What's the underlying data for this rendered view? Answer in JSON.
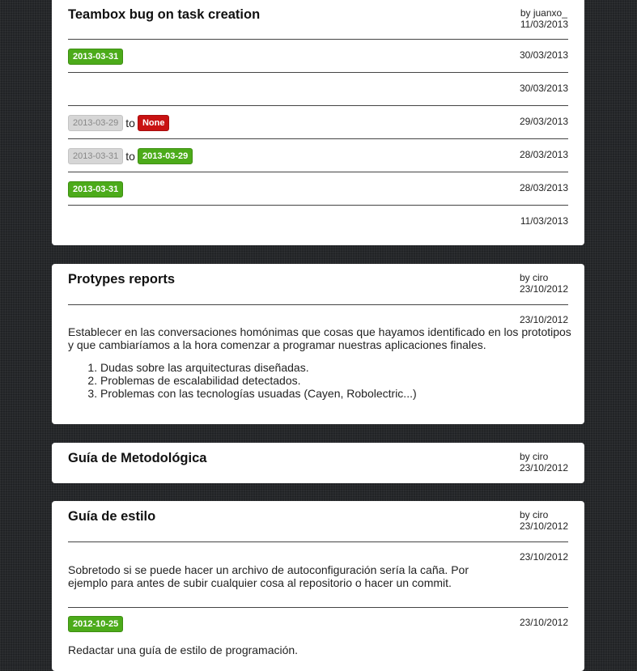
{
  "posts": [
    {
      "title": "Teambox bug on task creation",
      "author": "by juanxo_",
      "date": "11/03/2013",
      "rows": [
        {
          "from": null,
          "to": {
            "text": "2013-03-31",
            "color": "green"
          },
          "date": "30/03/2013"
        },
        {
          "from": null,
          "to": null,
          "date": "30/03/2013"
        },
        {
          "from": {
            "text": "2013-03-29",
            "color": "gray"
          },
          "to": {
            "text": "None",
            "color": "red"
          },
          "date": "29/03/2013"
        },
        {
          "from": {
            "text": "2013-03-31",
            "color": "gray"
          },
          "to": {
            "text": "2013-03-29",
            "color": "green"
          },
          "date": "28/03/2013"
        },
        {
          "from": null,
          "to": {
            "text": "2013-03-31",
            "color": "green"
          },
          "date": "28/03/2013"
        },
        {
          "from": null,
          "to": null,
          "date": "11/03/2013"
        }
      ],
      "to_word": "to"
    },
    {
      "title": "Protypes reports",
      "author": "by ciro",
      "date": "23/10/2012",
      "comment_date": "23/10/2012",
      "paragraph": "Establecer en las conversaciones homónimas que cosas que hayamos identificado en los prototipos y que cambiaríamos a la hora comenzar a programar nuestras aplicaciones finales.",
      "list": [
        "Dudas sobre las arquitecturas diseñadas.",
        "Problemas de escalabilidad detectados.",
        "Problemas con las tecnologías usuadas (Cayen, Robolectric...)"
      ]
    },
    {
      "title": "Guía de Metodológica",
      "author": "by ciro",
      "date": "23/10/2012"
    },
    {
      "title": "Guía de estilo",
      "author": "by ciro",
      "date": "23/10/2012",
      "comment1_date": "23/10/2012",
      "comment1_text": "Sobretodo si se puede hacer un archivo de autoconfiguración sería la caña. Por ejemplo para antes de subir cualquier cosa al repositorio o hacer un commit.",
      "comment2_badge": "2012-10-25",
      "comment2_date": "23/10/2012",
      "comment2_text": "Redactar una guía de estilo de programación."
    }
  ],
  "colors": {
    "green": "#4cab1a",
    "red": "#c91212",
    "gray": "#d6d6d6",
    "background": "#26282b"
  }
}
